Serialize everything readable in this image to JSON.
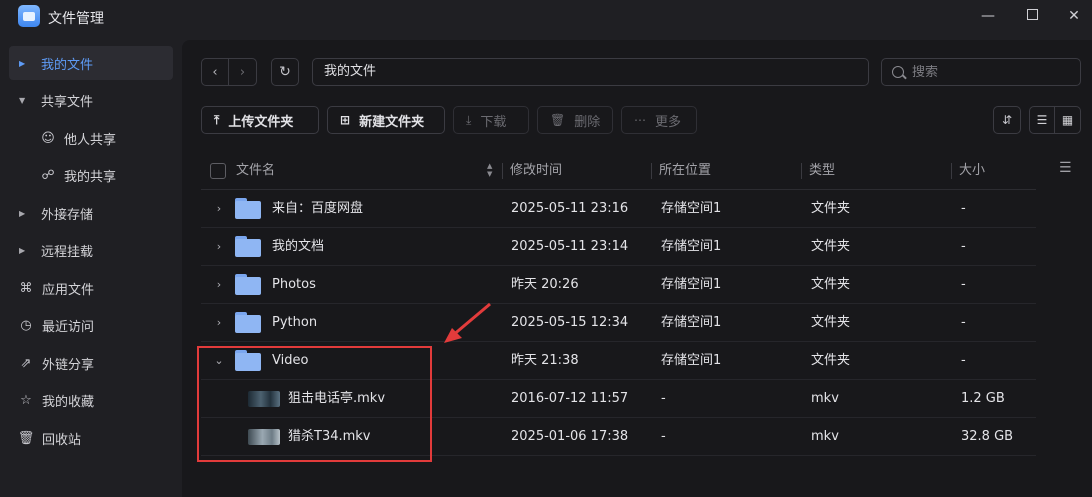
{
  "app": {
    "title": "文件管理"
  },
  "sidebar": {
    "items": [
      {
        "label": "我的文件",
        "kind": "caret",
        "active": true
      },
      {
        "label": "共享文件",
        "kind": "caret-open"
      },
      {
        "label": "他人共享",
        "kind": "sub",
        "icon": "users-icon"
      },
      {
        "label": "我的共享",
        "kind": "sub",
        "icon": "share-icon"
      },
      {
        "label": "外接存储",
        "kind": "caret"
      },
      {
        "label": "远程挂载",
        "kind": "caret"
      },
      {
        "label": "应用文件",
        "icon": "apps-icon"
      },
      {
        "label": "最近访问",
        "icon": "clock-icon"
      },
      {
        "label": "外链分享",
        "icon": "external-link-icon"
      },
      {
        "label": "我的收藏",
        "icon": "star-icon"
      },
      {
        "label": "回收站",
        "icon": "trash-icon"
      }
    ]
  },
  "path": {
    "current": "我的文件"
  },
  "search": {
    "placeholder": "搜索"
  },
  "toolbar": {
    "upload_label": "上传文件夹",
    "new_folder_label": "新建文件夹",
    "download_label": "下载",
    "delete_label": "删除",
    "more_label": "更多"
  },
  "table": {
    "headers": {
      "name": "文件名",
      "modified": "修改时间",
      "location": "所在位置",
      "type": "类型",
      "size": "大小"
    },
    "rows": [
      {
        "name": "来自：百度网盘",
        "modified": "2025-05-11 23:16",
        "location": "存储空间1",
        "type": "文件夹",
        "size": "-",
        "kind": "folder",
        "expanded": false
      },
      {
        "name": "我的文档",
        "modified": "2025-05-11 23:14",
        "location": "存储空间1",
        "type": "文件夹",
        "size": "-",
        "kind": "folder",
        "expanded": false
      },
      {
        "name": "Photos",
        "modified": "昨天 20:26",
        "location": "存储空间1",
        "type": "文件夹",
        "size": "-",
        "kind": "folder",
        "expanded": false
      },
      {
        "name": "Python",
        "modified": "2025-05-15 12:34",
        "location": "存储空间1",
        "type": "文件夹",
        "size": "-",
        "kind": "folder",
        "expanded": false
      },
      {
        "name": "Video",
        "modified": "昨天 21:38",
        "location": "存储空间1",
        "type": "文件夹",
        "size": "-",
        "kind": "folder",
        "expanded": true
      },
      {
        "name": "狙击电话亭.mkv",
        "modified": "2016-07-12 11:57",
        "location": "-",
        "type": "mkv",
        "size": "1.2 GB",
        "kind": "video",
        "thumb": 1
      },
      {
        "name": "猎杀T34.mkv",
        "modified": "2025-01-06 17:38",
        "location": "-",
        "type": "mkv",
        "size": "32.8 GB",
        "kind": "video",
        "thumb": 2
      }
    ]
  },
  "colors": {
    "accent": "#5e9bf5",
    "annotation": "#e23b3b",
    "folder": "#8fb6f3"
  }
}
